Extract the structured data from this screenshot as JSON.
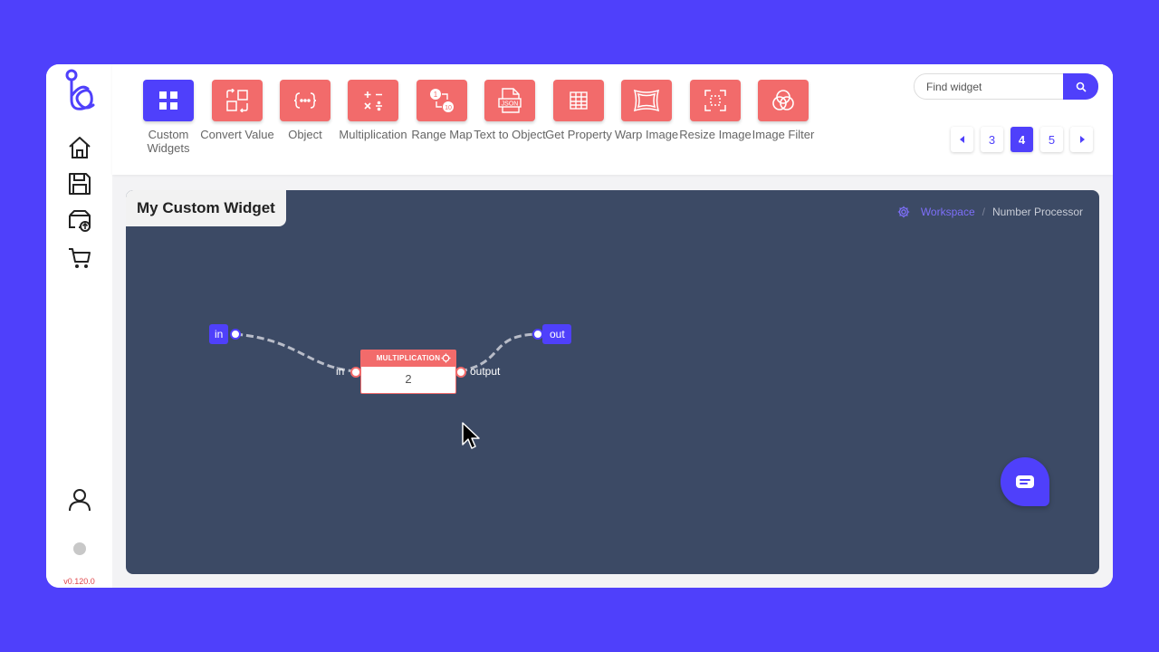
{
  "sidebar": {
    "nav_icons": [
      "home-icon",
      "save-icon",
      "upload-box-icon",
      "cart-icon",
      "user-icon"
    ],
    "version": "v0.120.0"
  },
  "toolbar": {
    "widgets": [
      {
        "label": "Custom Widgets",
        "icon": "grid-icon",
        "active": true
      },
      {
        "label": "Convert Value",
        "icon": "convert-icon",
        "active": false
      },
      {
        "label": "Object",
        "icon": "object-icon",
        "active": false
      },
      {
        "label": "Multiplication",
        "icon": "math-icon",
        "active": false
      },
      {
        "label": "Range Map",
        "icon": "range-map-icon",
        "active": false
      },
      {
        "label": "Text to Object",
        "icon": "json-file-icon",
        "active": false
      },
      {
        "label": "Get Property",
        "icon": "table-icon",
        "active": false
      },
      {
        "label": "Warp Image",
        "icon": "warp-icon",
        "active": false
      },
      {
        "label": "Resize Image",
        "icon": "resize-icon",
        "active": false
      },
      {
        "label": "Image Filter",
        "icon": "filter-icon",
        "active": false
      }
    ],
    "search": {
      "placeholder": "Find widget"
    },
    "pagination": {
      "pages": [
        "3",
        "4",
        "5"
      ],
      "current": "4"
    }
  },
  "workspace": {
    "title": "My Custom Widget",
    "breadcrumb": {
      "root": "Workspace",
      "current": "Number Processor"
    },
    "input_node": "in",
    "output_node": "out",
    "multiplication_node": {
      "title": "MULTIPLICATION",
      "value": "2",
      "input_label": "in",
      "output_label": "output"
    }
  },
  "colors": {
    "accent": "#4f40fb",
    "widget_tile": "#f26b6b",
    "canvas": "#3c4a65"
  }
}
